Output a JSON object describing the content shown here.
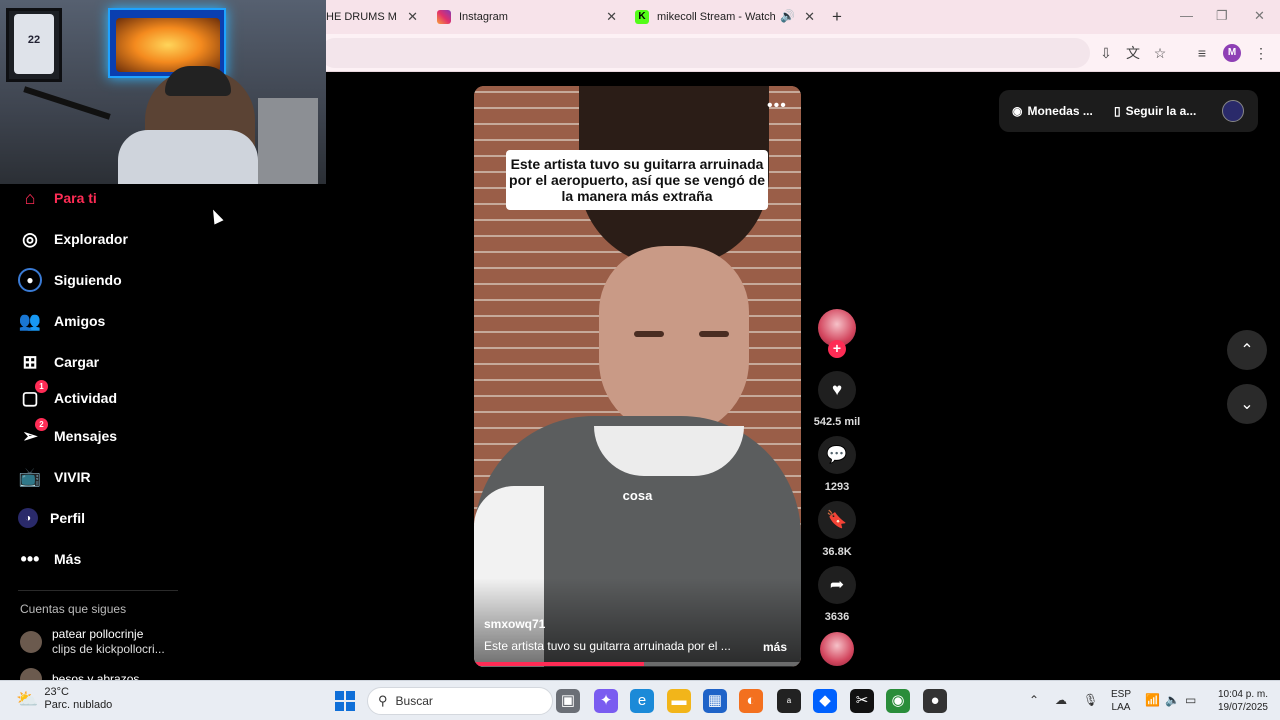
{
  "browser": {
    "tabs": [
      {
        "title": "HE DRUMS ME IL"
      },
      {
        "title": "Instagram"
      },
      {
        "title": "mikecoll Stream - Watch Liv"
      }
    ],
    "profile_initial": "M"
  },
  "webcam": {
    "jersey_text": "22"
  },
  "sidebar": {
    "items": [
      {
        "label": "Para ti",
        "icon": "home-icon",
        "active": true
      },
      {
        "label": "Explorador",
        "icon": "compass-icon"
      },
      {
        "label": "Siguiendo",
        "icon": "following-icon"
      },
      {
        "label": "Amigos",
        "icon": "friends-icon"
      },
      {
        "label": "Cargar",
        "icon": "upload-icon"
      },
      {
        "label": "Actividad",
        "icon": "activity-icon",
        "badge": "1"
      },
      {
        "label": "Mensajes",
        "icon": "messages-icon",
        "badge": "2"
      },
      {
        "label": "VIVIR",
        "icon": "live-icon"
      },
      {
        "label": "Perfil",
        "icon": "profile-icon"
      },
      {
        "label": "Más",
        "icon": "more-icon"
      }
    ],
    "following_header": "Cuentas que sigues",
    "following": [
      {
        "name": "patear pollocrinje",
        "sub": "clips de kickpollocri..."
      },
      {
        "name": "besos y abrazos",
        "sub": ""
      }
    ]
  },
  "video": {
    "caption": "Este artista tuvo su guitarra arruinada por el aeropuerto, así que se vengó de la manera más extraña",
    "subtitle": "cosa",
    "username": "smxowq71",
    "description": "Este artista tuvo su guitarra arruinada por el ...",
    "more_label": "más",
    "progress": 0.52
  },
  "actions": {
    "likes": "542.5 mil",
    "comments": "1293",
    "saves": "36.8K",
    "shares": "3636"
  },
  "top_pill": {
    "coins_label": "Monedas ...",
    "follow_label": "Seguir la a..."
  },
  "taskbar": {
    "temperature": "23°C",
    "weather": "Parc. nublado",
    "search_placeholder": "Buscar",
    "lang_line1": "ESP",
    "lang_line2": "LAA",
    "time": "10:04 p. m.",
    "date": "19/07/2025"
  },
  "colors": {
    "accent": "#fe2c55",
    "taskbar": "#e9edf3",
    "tabbar": "#f7e3ea"
  }
}
